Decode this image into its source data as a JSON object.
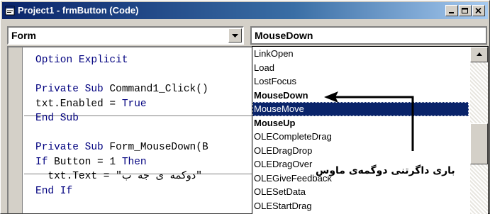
{
  "window": {
    "title": "Project1 - frmButton (Code)"
  },
  "object_combo": {
    "value": "Form"
  },
  "procedure_combo": {
    "value": "MouseDown"
  },
  "code": {
    "lines": [
      [
        {
          "t": "Option Explicit",
          "k": true
        }
      ],
      [
        {
          "t": "",
          "k": false
        }
      ],
      [
        {
          "t": "Private Sub",
          "k": true
        },
        {
          "t": " Command1_Click()",
          "k": false
        }
      ],
      [
        {
          "t": "txt.Enabled = ",
          "k": false
        },
        {
          "t": "True",
          "k": true
        }
      ],
      [
        {
          "t": "End Sub",
          "k": true
        }
      ],
      [
        {
          "t": "",
          "k": false
        }
      ],
      [
        {
          "t": "Private Sub",
          "k": true
        },
        {
          "t": " Form_MouseDown(B",
          "k": false
        }
      ],
      [
        {
          "t": "If",
          "k": true
        },
        {
          "t": " Button = 1 ",
          "k": false
        },
        {
          "t": "Then",
          "k": true
        }
      ],
      [
        {
          "t": "  txt.Text = \"دوکمه ی جه ب\"",
          "k": false
        }
      ],
      [
        {
          "t": "End If",
          "k": true
        }
      ]
    ]
  },
  "dropdown": {
    "items": [
      {
        "label": "LinkOpen",
        "bold": false,
        "selected": false
      },
      {
        "label": "Load",
        "bold": false,
        "selected": false
      },
      {
        "label": "LostFocus",
        "bold": false,
        "selected": false
      },
      {
        "label": "MouseDown",
        "bold": true,
        "selected": false
      },
      {
        "label": "MouseMove",
        "bold": false,
        "selected": true
      },
      {
        "label": "MouseUp",
        "bold": true,
        "selected": false
      },
      {
        "label": "OLECompleteDrag",
        "bold": false,
        "selected": false
      },
      {
        "label": "OLEDragDrop",
        "bold": false,
        "selected": false
      },
      {
        "label": "OLEDragOver",
        "bold": false,
        "selected": false
      },
      {
        "label": "OLEGiveFeedback",
        "bold": false,
        "selected": false
      },
      {
        "label": "OLESetData",
        "bold": false,
        "selected": false
      },
      {
        "label": "OLEStartDrag",
        "bold": false,
        "selected": false
      }
    ]
  },
  "annotation": {
    "text": "باری داگرتنی دوگمەی ماوس"
  },
  "colors": {
    "keyword": "#00007f",
    "selection": "#0a246a",
    "title_start": "#0a246a",
    "title_end": "#a6caf0"
  }
}
